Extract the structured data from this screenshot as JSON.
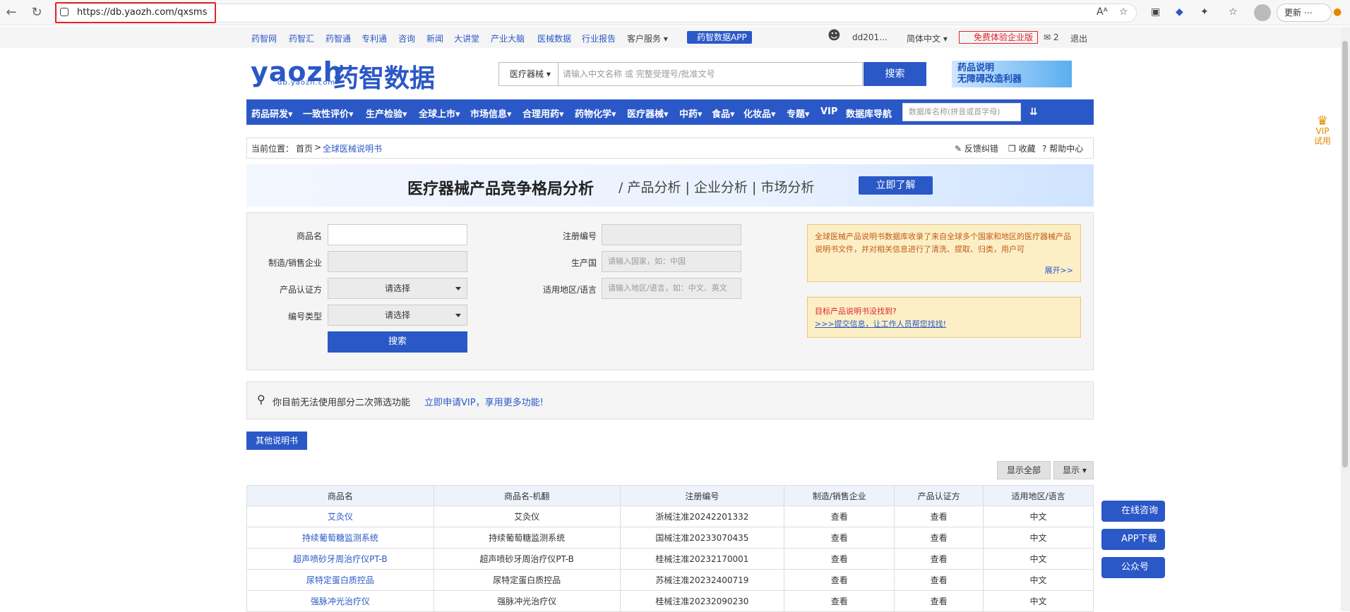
{
  "browser": {
    "url": "https://db.yaozh.com/qxsms",
    "update_label": "更新",
    "more_label": "⋯"
  },
  "topnav": {
    "links": [
      "药智网",
      "药智汇",
      "药智通",
      "专利通",
      "咨询",
      "新闻",
      "大讲堂",
      "产业大脑",
      "医械数据",
      "行业报告"
    ],
    "customer_service": "客户服务",
    "app_label": "药智数据APP",
    "username": "dd201...",
    "language": "简体中文",
    "free_trial": "免费体验企业版",
    "mail_count": "2",
    "logout": "退出"
  },
  "header": {
    "logo_en": "yaozh",
    "logo_cn": "药智数据",
    "logo_sub": "db.yaozh.com",
    "search_category": "医疗器械",
    "search_placeholder": "请输入中文名称 或 完整受理号/批准文号",
    "search_button": "搜索",
    "promo_line1": "药品说明",
    "promo_line2": "无障碍改造利器"
  },
  "mainnav": {
    "items": [
      "药品研发",
      "一致性评价",
      "生产检验",
      "全球上市",
      "市场信息",
      "合理用药",
      "药物化学",
      "医疗器械",
      "中药",
      "食品",
      "化妆品",
      "专题",
      "VIP",
      "数据库导航"
    ],
    "search_placeholder": "数据库名称(拼音或首字母)"
  },
  "breadcrumb": {
    "prefix": "当前位置：",
    "home": "首页",
    "sep": ">",
    "current": "全球医械说明书",
    "feedback": "反馈纠错",
    "favorite": "收藏",
    "help": "帮助中心"
  },
  "banner": {
    "title": "医疗器械产品竞争格局分析",
    "subtitle": "/ 产品分析 | 企业分析 | 市场分析",
    "button": "立即了解"
  },
  "form": {
    "product_name_label": "商品名",
    "manufacturer_label": "制造/销售企业",
    "cert_label": "产品认证方",
    "cert_value": "请选择",
    "code_type_label": "编号类型",
    "code_type_value": "请选择",
    "reg_no_label": "注册编号",
    "country_label": "生产国",
    "country_placeholder": "请输入国家，如：中国",
    "region_label": "适用地区/语言",
    "region_placeholder": "请输入地区/语言，如：中文、英文",
    "search_button": "搜索",
    "note_text": "全球医械产品说明书数据库收录了来自全球多个国家和地区的医疗器械产品说明书文件，并对相关信息进行了清洗、提取、归类，用户可",
    "note_expand": "展开>>",
    "missing_title": "目标产品说明书没找到?",
    "missing_link": ">>>提交信息，让工作人员帮您找找!"
  },
  "vip_notice": {
    "text": "你目前无法使用部分二次筛选功能",
    "link": "立即申请VIP，享用更多功能!"
  },
  "toolbar": {
    "other_manuals": "其他说明书",
    "show_all": "显示全部",
    "show": "显示"
  },
  "table": {
    "headers": [
      "商品名",
      "商品名-机翻",
      "注册编号",
      "制造/销售企业",
      "产品认证方",
      "适用地区/语言"
    ],
    "rows": [
      [
        "艾灸仪",
        "艾灸仪",
        "浙械注准20242201332",
        "查看",
        "查看",
        "中文"
      ],
      [
        "持续葡萄糖监测系统",
        "持续葡萄糖监测系统",
        "国械注准20233070435",
        "查看",
        "查看",
        "中文"
      ],
      [
        "超声喷砂牙周治疗仪PT-B",
        "超声喷砂牙周治疗仪PT-B",
        "桂械注准20232170001",
        "查看",
        "查看",
        "中文"
      ],
      [
        "尿特定蛋白质控品",
        "尿特定蛋白质控品",
        "苏械注准20232400719",
        "查看",
        "查看",
        "中文"
      ],
      [
        "强脉冲光治疗仪",
        "强脉冲光治疗仪",
        "桂械注准20232090230",
        "查看",
        "查看",
        "中文"
      ]
    ]
  },
  "float": {
    "consult": "在线咨询",
    "app": "APP下载",
    "wechat": "公众号",
    "vip1": "VIP",
    "vip2": "试用"
  }
}
